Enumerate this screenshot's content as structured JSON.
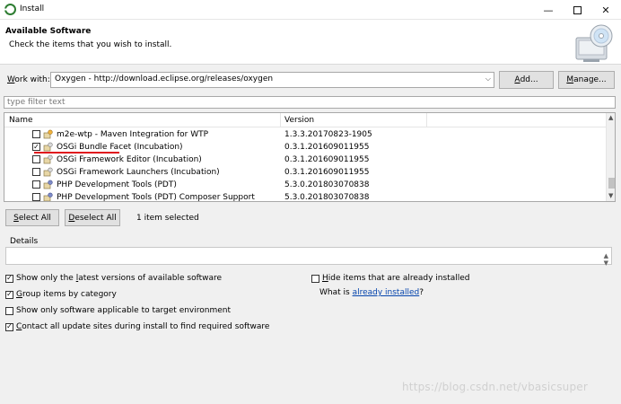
{
  "window": {
    "title": "Install"
  },
  "header": {
    "title": "Available Software",
    "subtitle": "Check the items that you wish to install."
  },
  "work_with": {
    "label_prefix": "",
    "label_accel": "W",
    "label_rest": "ork with:",
    "value": "Oxygen - http://download.eclipse.org/releases/oxygen",
    "add_accel": "A",
    "add_rest": "dd...",
    "manage_prefix": "",
    "manage_accel": "M",
    "manage_rest": "anage..."
  },
  "filter": {
    "placeholder": "type filter text"
  },
  "table": {
    "columns": [
      "Name",
      "Version"
    ],
    "rows": [
      {
        "name": "m2e-wtp - Maven Integration for WTP",
        "version": "1.3.3.20170823-1905",
        "checked": false
      },
      {
        "name": "OSGi Bundle Facet (Incubation)",
        "version": "0.3.1.201609011955",
        "checked": true
      },
      {
        "name": "OSGi Framework Editor (Incubation)",
        "version": "0.3.1.201609011955",
        "checked": false
      },
      {
        "name": "OSGi Framework Launchers (Incubation)",
        "version": "0.3.1.201609011955",
        "checked": false
      },
      {
        "name": "PHP Development Tools (PDT)",
        "version": "5.3.0.201803070838",
        "checked": false
      },
      {
        "name": "PHP Development Tools (PDT) Composer Support",
        "version": "5.3.0.201803070838",
        "checked": false
      }
    ]
  },
  "buttons": {
    "select_all_accel": "S",
    "select_all_rest": "elect All",
    "deselect_all_accel": "D",
    "deselect_all_rest": "eselect All"
  },
  "selection_status": "1 item selected",
  "details": {
    "label": "Details"
  },
  "options": {
    "latest_pre": "Show only the ",
    "latest_accel": "l",
    "latest_post": "atest versions of available software",
    "group_pre": "",
    "group_accel": "G",
    "group_post": "roup items by category",
    "target_text": "Show only software applicable to target environment",
    "contact_pre": "",
    "contact_accel": "C",
    "contact_post": "ontact all update sites during install to find required software",
    "hide_pre": "",
    "hide_accel": "H",
    "hide_post": "ide items that are already installed",
    "whatis_pre": "What is ",
    "whatis_link": "already installed",
    "whatis_post": "?",
    "latest_checked": true,
    "group_checked": true,
    "target_checked": false,
    "contact_checked": true,
    "hide_checked": false
  },
  "watermark": "https://blog.csdn.net/vbasicsuper",
  "colors": {
    "accent_underline": "#e0171d",
    "link": "#0645ad"
  }
}
